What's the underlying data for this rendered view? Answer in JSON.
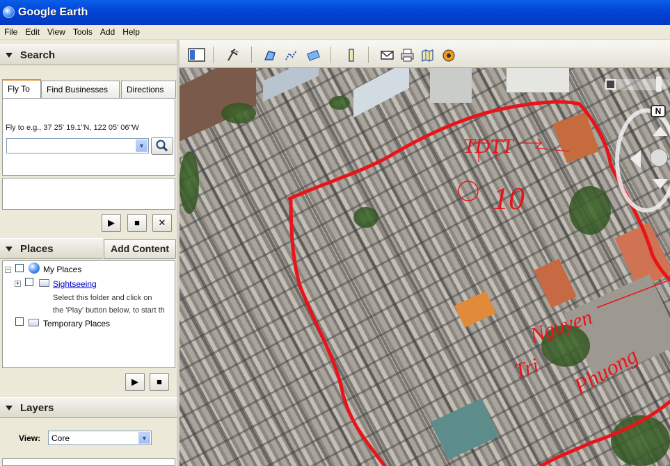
{
  "window": {
    "title": "Google Earth"
  },
  "menu": [
    "File",
    "Edit",
    "View",
    "Tools",
    "Add",
    "Help"
  ],
  "search": {
    "header": "Search",
    "tabs": [
      "Fly To",
      "Find Businesses",
      "Directions"
    ],
    "hint": "Fly to e.g., 37 25' 19.1\"N, 122 05' 06\"W",
    "input_value": ""
  },
  "places": {
    "header": "Places",
    "add_content": "Add Content",
    "items": [
      {
        "label": "My Places"
      },
      {
        "label": "Sightseeing"
      },
      {
        "label": "Temporary Places"
      }
    ],
    "description_line1": "Select this folder and click on",
    "description_line2": "the 'Play' button below, to start th"
  },
  "layers": {
    "header": "Layers",
    "view_label": "View:",
    "view_value": "Core"
  },
  "map": {
    "annotations": [
      "TDTT",
      "10",
      "Nguyen",
      "Tri",
      "Phuong"
    ],
    "compass": "N"
  },
  "colors": {
    "titlebar": "#0347d6",
    "annotation": "#e8141a",
    "panel": "#ece9d8"
  }
}
